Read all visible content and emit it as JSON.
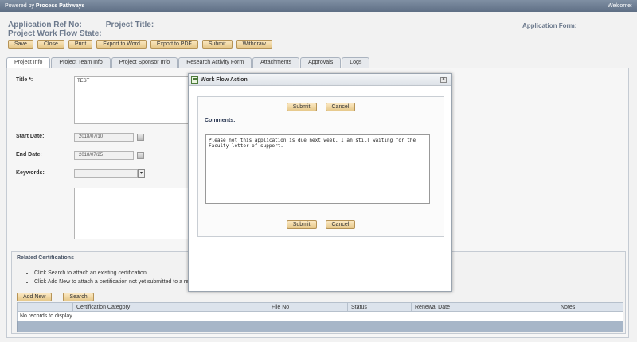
{
  "topbar": {
    "brand_prefix": "Powered by ",
    "brand_name": "Process Pathways",
    "welcome": "Welcome:"
  },
  "header": {
    "app_ref": "Application Ref No:",
    "project_title": "Project Title:",
    "workflow_state": "Project Work Flow State:",
    "application_form": "Application Form:"
  },
  "toolbar": {
    "save": "Save",
    "close": "Close",
    "print": "Print",
    "export_word": "Export to Word",
    "export_pdf": "Export to PDF",
    "submit": "Submit",
    "withdraw": "Withdraw"
  },
  "tabs": [
    "Project Info",
    "Project Team Info",
    "Project Sponsor Info",
    "Research Activity Form",
    "Attachments",
    "Approvals",
    "Logs"
  ],
  "form": {
    "title_label": "Title *:",
    "title_value": "TEST",
    "start_label": "Start Date:",
    "start_value": "2018/07/10",
    "end_label": "End Date:",
    "end_value": "2018/07/25",
    "keywords_label": "Keywords:"
  },
  "certs": {
    "title": "Related Certifications",
    "bullet1": "Click Search to attach an existing certification",
    "bullet2": "Click Add New to attach a certification not yet submitted to a revi",
    "add_new": "Add New",
    "search": "Search",
    "columns": [
      "",
      "",
      "Certification Category",
      "File No",
      "Status",
      "Renewal Date",
      "Notes"
    ],
    "empty": "No records to display."
  },
  "modal": {
    "title": "Work Flow Action",
    "submit": "Submit",
    "cancel": "Cancel",
    "comments_label": "Comments:",
    "comment_text": "Please not this application is due next week. I am still waiting for the Faculty letter of support."
  }
}
